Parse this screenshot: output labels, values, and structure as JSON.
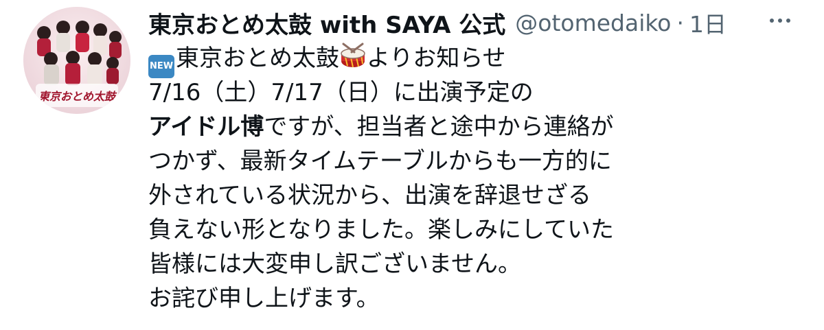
{
  "tweet": {
    "display_name": "東京おとめ太鼓 with SAYA 公式",
    "handle": "@otomedaiko",
    "separator": "·",
    "time": "1日",
    "new_badge": "NEW",
    "line1_text": "東京おとめ太鼓",
    "line1_after": "よりお知らせ",
    "line2": "7/16（土）7/17（日）に出演予定の",
    "line3_bold": "アイドル博",
    "line3_rest": "ですが、担当者と途中から連絡が",
    "line4": "つかず、最新タイムテーブルからも一方的に",
    "line5": "外されている状況から、出演を辞退せざる",
    "line6": "負えない形となりました。楽しみにしていた",
    "line7": "皆様には大変申し訳ございません。",
    "line8": "お詫び申し上げます。",
    "icons": {
      "avatar": "profile-photo",
      "new_badge": "new-button-emoji",
      "drum": "drum-emoji",
      "more": "more-options-icon"
    },
    "colors": {
      "text": "#0f1419",
      "secondary": "#536471",
      "badge": "#3b88c3",
      "drum_red": "#d32f2f"
    },
    "avatar_logo_text": "東京おとめ太鼓"
  }
}
